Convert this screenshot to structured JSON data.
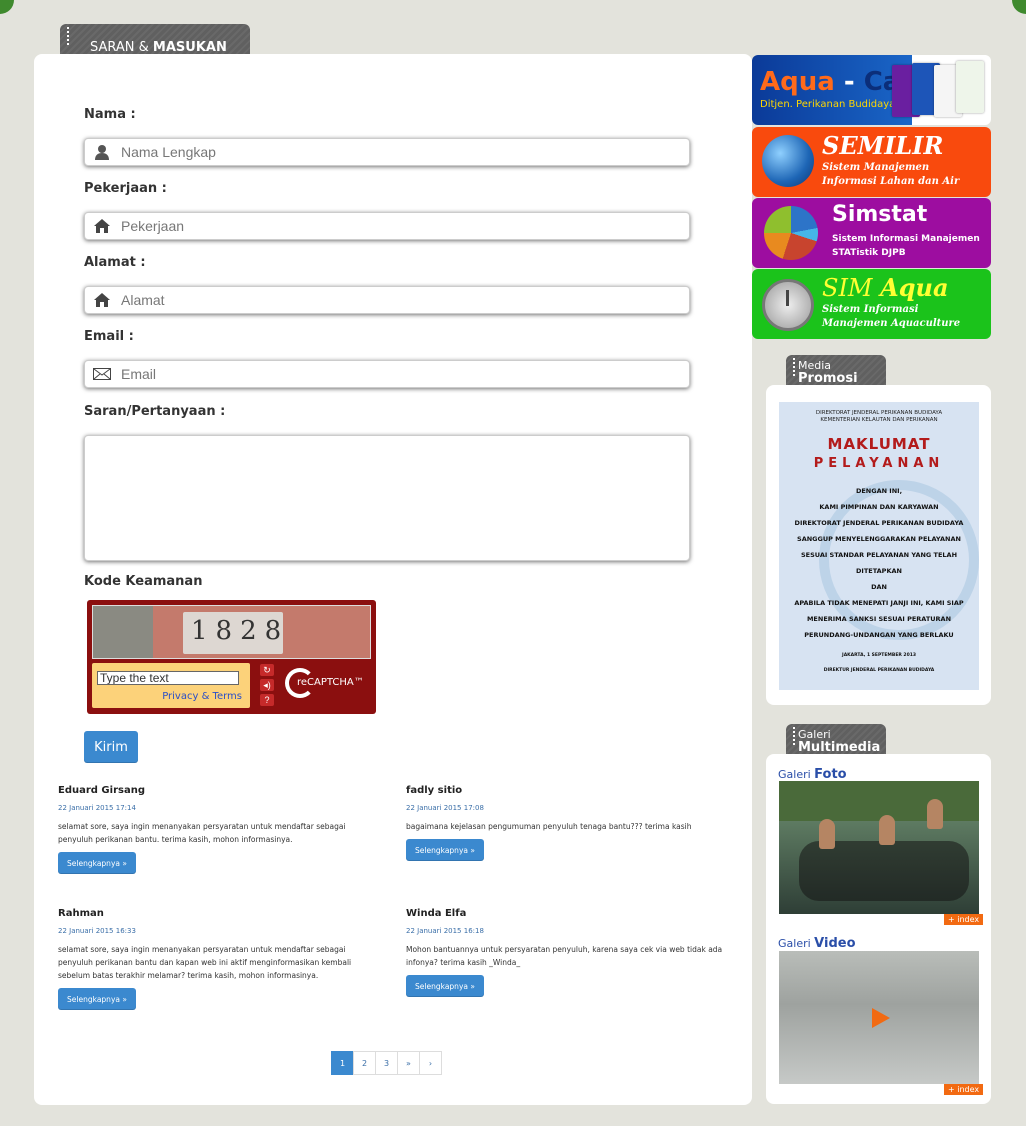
{
  "form": {
    "tab_title_light": "SARAN &",
    "tab_title_bold": "MASUKAN",
    "nama_label": "Nama :",
    "nama_placeholder": "Nama Lengkap",
    "pekerjaan_label": "Pekerjaan :",
    "pekerjaan_placeholder": "Pekerjaan",
    "alamat_label": "Alamat :",
    "alamat_placeholder": "Alamat",
    "email_label": "Email :",
    "email_placeholder": "Email",
    "saran_label": "Saran/Pertanyaan :",
    "kode_label": "Kode Keamanan",
    "captcha_text": "1828",
    "captcha_placeholder": "Type the text",
    "captcha_privacy": "Privacy & Terms",
    "captcha_brand": "reCAPTCHA™",
    "submit_label": "Kirim"
  },
  "posts": [
    {
      "name": "Eduard Girsang",
      "date": "22 Januari 2015 17:14",
      "body": "selamat sore, saya ingin menanyakan persyaratan untuk mendaftar sebagai penyuluh perikanan bantu. terima kasih, mohon informasinya.",
      "more": "Selengkapnya »"
    },
    {
      "name": "fadly sitio",
      "date": "22 Januari 2015 17:08",
      "body": "bagaimana kejelasan pengumuman penyuluh tenaga bantu??? terima kasih",
      "more": "Selengkapnya »"
    },
    {
      "name": "Rahman",
      "date": "22 Januari 2015 16:33",
      "body": "selamat sore, saya ingin menanyakan persyaratan untuk mendaftar sebagai penyuluh perikanan bantu dan kapan web ini aktif menginformasikan kembali sebelum batas terakhir melamar? terima kasih, mohon informasinya.",
      "more": "Selengkapnya »"
    },
    {
      "name": "Winda Elfa",
      "date": "22 Januari 2015 16:18",
      "body": "Mohon bantuannya untuk persyaratan penyuluh, karena saya cek via web tidak ada infonya? terima kasih _Winda_",
      "more": "Selengkapnya »"
    }
  ],
  "pager": {
    "p1": "1",
    "p2": "2",
    "p3": "3",
    "next": "»",
    "last": "›",
    "current": 1
  },
  "banners": {
    "aqua_a": "Aqua",
    "aqua_dash": "-",
    "aqua_b": "Card",
    "aqua_sub": "Ditjen. Perikanan Budidaya",
    "semilir_title": "SEMILIR",
    "semilir_sub": "Sistem Manajemen Informasi Lahan dan Air",
    "simstat_title": "Simstat",
    "simstat_sub": "Sistem Informasi Manajemen STATistik DJPB",
    "simaqua_title_a": "SIM",
    "simaqua_title_b": "Aqua",
    "simaqua_sub": "Sistem Informasi Manajemen Aquaculture",
    "colors": {
      "semilir": "#f94a0d",
      "simstat": "#9d0da0",
      "simaqua": "#1bc31b"
    }
  },
  "media": {
    "tab_small": "Media",
    "tab_big": "Promosi",
    "header": "DIREKTORAT JENDERAL PERIKANAN BUDIDAYA KEMENTERIAN KELAUTAN DAN PERIKANAN",
    "title1": "MAKLUMAT",
    "title2": "PELAYANAN",
    "lines": [
      "DENGAN INI,",
      "KAMI PIMPINAN DAN KARYAWAN",
      "DIREKTORAT JENDERAL PERIKANAN BUDIDAYA",
      "SANGGUP MENYELENGGARAKAN PELAYANAN",
      "SESUAI STANDAR PELAYANAN YANG TELAH",
      "DITETAPKAN",
      "DAN",
      "APABILA TIDAK MENEPATI JANJI INI, KAMI SIAP",
      "MENERIMA SANKSI SESUAI PERATURAN",
      "PERUNDANG-UNDANGAN YANG BERLAKU"
    ],
    "place_date": "JAKARTA, 1 SEPTEMBER 2013",
    "signer": "DIREKTUR JENDERAL PERIKANAN BUDIDAYA"
  },
  "gallery": {
    "tab_small": "Galeri",
    "tab_big": "Multimedia",
    "foto_light": "Galeri",
    "foto_bold": "Foto",
    "video_light": "Galeri",
    "video_bold": "Video",
    "index_label": "+ index"
  }
}
